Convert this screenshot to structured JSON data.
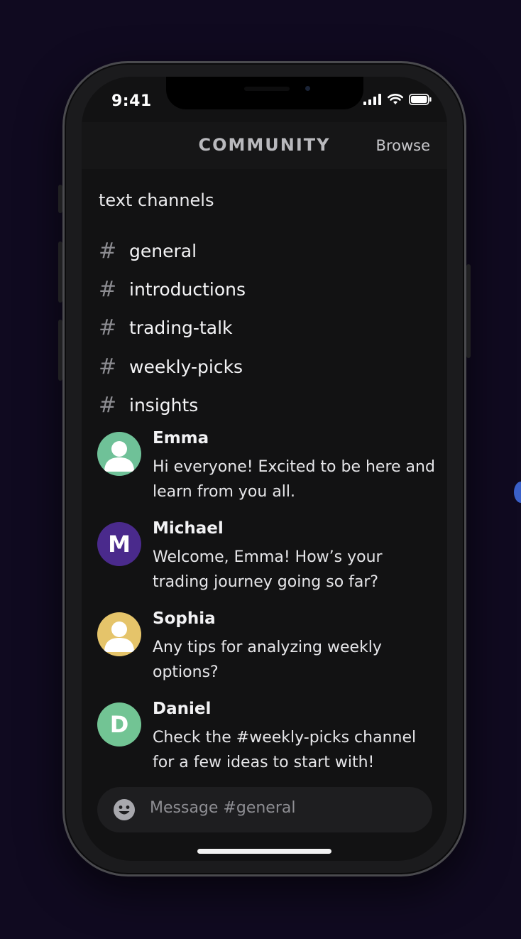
{
  "status_bar": {
    "time": "9:41"
  },
  "header": {
    "title": "COMMUNITY",
    "browse_label": "Browse"
  },
  "section": {
    "label": "text channels"
  },
  "channels": [
    {
      "hash": "#",
      "name": "general"
    },
    {
      "hash": "#",
      "name": "introductions"
    },
    {
      "hash": "#",
      "name": "trading-talk"
    },
    {
      "hash": "#",
      "name": "weekly-picks"
    },
    {
      "hash": "#",
      "name": "insights"
    }
  ],
  "messages": [
    {
      "name": "Emma",
      "text": "Hi everyone! Excited to be here and learn from you all.",
      "avatar": {
        "type": "person-icon",
        "color": "#6fc198"
      }
    },
    {
      "name": "Michael",
      "text": "Welcome, Emma! How’s your trading journey going so far?",
      "avatar": {
        "type": "letter",
        "letter": "M",
        "color": "#4a2a8c"
      }
    },
    {
      "name": "Sophia",
      "text": "Any tips for analyzing weekly options?",
      "avatar": {
        "type": "person-icon",
        "color": "#e5c46a"
      }
    },
    {
      "name": "Daniel",
      "text": "Check the #weekly-picks channel for a few ideas to start with!",
      "avatar": {
        "type": "letter",
        "letter": "D",
        "color": "#72c494"
      }
    }
  ],
  "composer": {
    "placeholder": "Message #general"
  },
  "colors": {
    "background": "#100a20",
    "screen": "#121213",
    "accent_dot": "#3a60c8"
  }
}
